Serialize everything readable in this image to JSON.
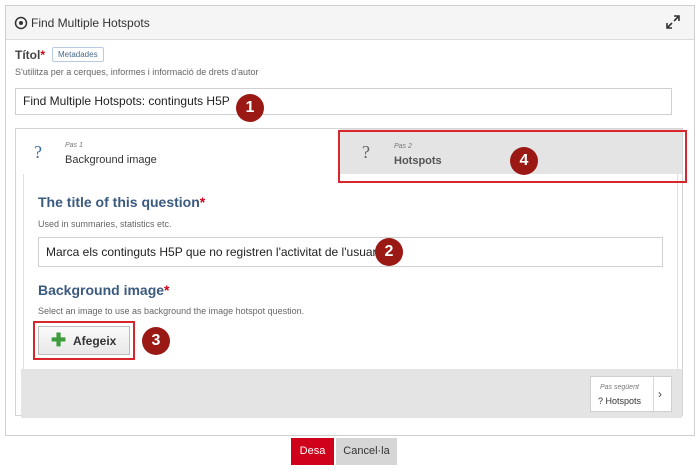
{
  "header": {
    "title": "Find Multiple Hotspots"
  },
  "title_field": {
    "label": "Títol",
    "required_mark": "*",
    "metadata_tag": "Metadades",
    "description": "S'utilitza per a cerques, informes i informació de drets d'autor",
    "value": "Find Multiple Hotspots: continguts H5P"
  },
  "steps": [
    {
      "step_label": "Pas 1",
      "name": "Background image",
      "icon": "?"
    },
    {
      "step_label": "Pas 2",
      "name": "Hotspots",
      "icon": "?"
    }
  ],
  "question": {
    "title": "The title of this question",
    "required_mark": "*",
    "description": "Used in summaries, statistics etc.",
    "value": "Marca els continguts H5P que no registren l'activitat de l'usuari"
  },
  "background": {
    "title": "Background image",
    "required_mark": "*",
    "description": "Select an image to use as background the image hotspot question.",
    "add_label": "Afegeix"
  },
  "next": {
    "step_label": "Pas següent",
    "name": "? Hotspots",
    "chevron": "›"
  },
  "actions": {
    "save": "Desa",
    "cancel": "Cancel·la"
  },
  "callouts": [
    "1",
    "2",
    "3",
    "4"
  ],
  "colors": {
    "accent": "#d0021b",
    "heading": "#3b5a80",
    "callout": "#9b1915"
  }
}
